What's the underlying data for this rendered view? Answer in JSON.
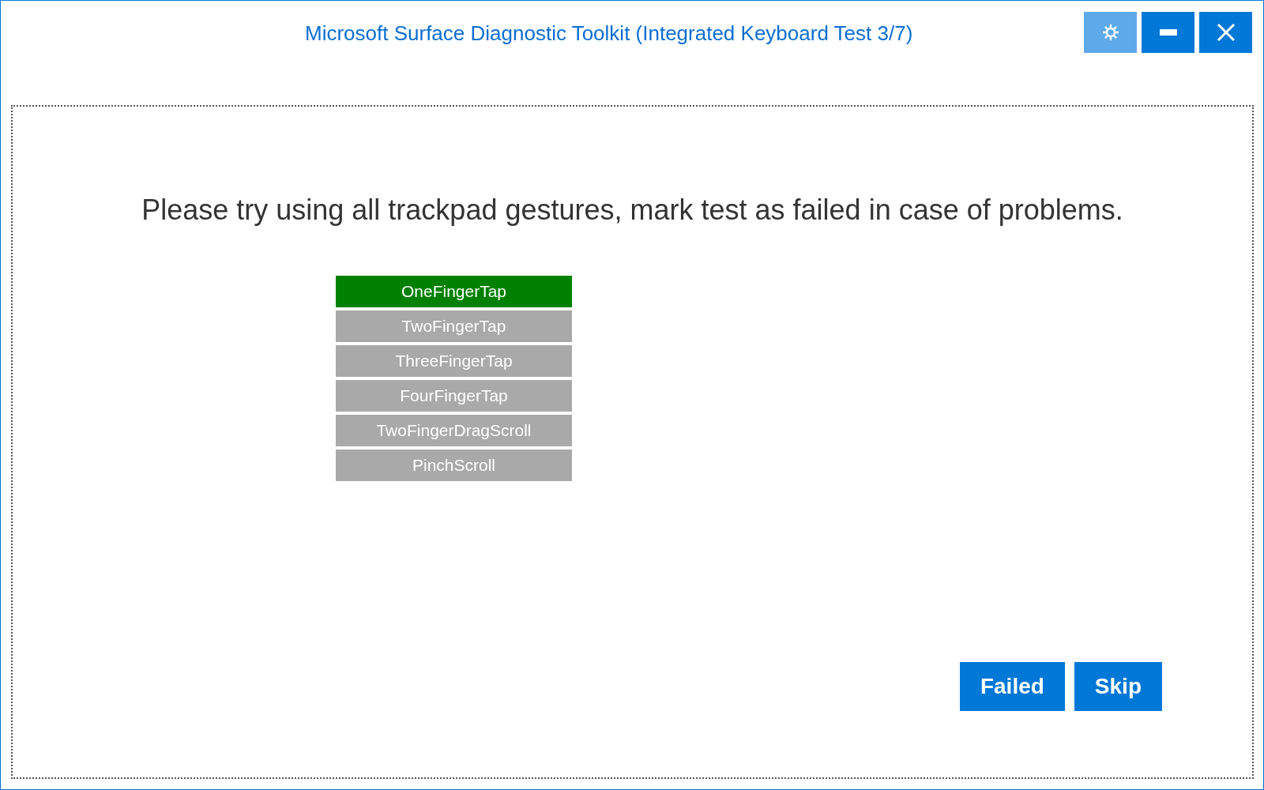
{
  "window": {
    "title": "Microsoft Surface Diagnostic Toolkit (Integrated Keyboard Test 3/7)"
  },
  "instruction": "Please try using all trackpad gestures, mark test as failed in case of problems.",
  "gestures": [
    {
      "label": "OneFingerTap",
      "passed": true
    },
    {
      "label": "TwoFingerTap",
      "passed": false
    },
    {
      "label": "ThreeFingerTap",
      "passed": false
    },
    {
      "label": "FourFingerTap",
      "passed": false
    },
    {
      "label": "TwoFingerDragScroll",
      "passed": false
    },
    {
      "label": "PinchScroll",
      "passed": false
    }
  ],
  "buttons": [
    "Failed",
    "Skip"
  ]
}
